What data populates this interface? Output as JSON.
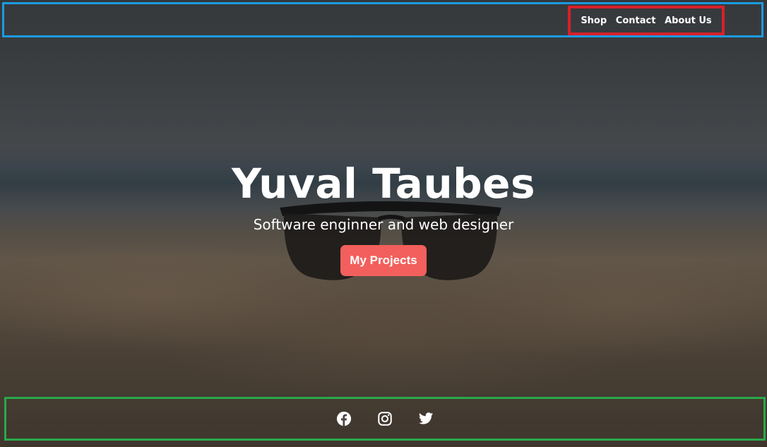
{
  "nav": {
    "links": [
      "Shop",
      "Contact",
      "About Us"
    ]
  },
  "hero": {
    "title": "Yuval Taubes",
    "subtitle": "Software enginner and web designer",
    "button_label": "My Projects"
  },
  "footer": {
    "social_icons": [
      "facebook-icon",
      "instagram-icon",
      "twitter-icon"
    ]
  },
  "colors": {
    "button": "#f25f5c",
    "nav_border": "#1b9be0",
    "links_border": "#d9202a",
    "footer_border": "#2aa84a"
  }
}
